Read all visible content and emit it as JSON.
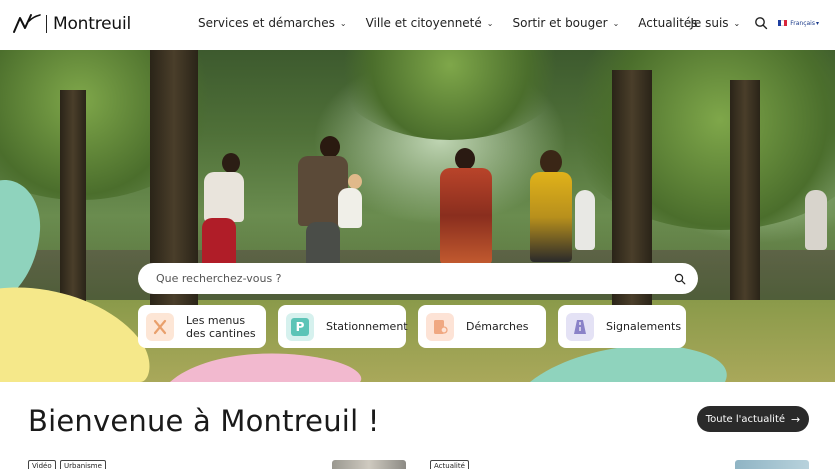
{
  "header": {
    "logo_text": "Montreuil",
    "nav": [
      {
        "label": "Services et démarches"
      },
      {
        "label": "Ville et citoyenneté"
      },
      {
        "label": "Sortir et bouger"
      },
      {
        "label": "Actualités"
      }
    ],
    "je_suis": "Je suis",
    "language": "Français"
  },
  "search": {
    "placeholder": "Que recherchez-vous ?"
  },
  "quick_links": [
    {
      "label_line1": "Les menus",
      "label_line2": "des cantines",
      "icon": "fork-knife-icon",
      "icon_bg": "#fde6d6",
      "icon_color": "#e9b78c"
    },
    {
      "label_line1": "Stationnement",
      "label_line2": "",
      "icon": "parking-icon",
      "icon_bg": "#d6f1ee",
      "icon_color": "#5cc4b7"
    },
    {
      "label_line1": "Démarches",
      "label_line2": "",
      "icon": "document-icon",
      "icon_bg": "#fde3d6",
      "icon_color": "#f0a882"
    },
    {
      "label_line1": "Signalements",
      "label_line2": "",
      "icon": "road-icon",
      "icon_bg": "#e4e2f5",
      "icon_color": "#8a82c8"
    }
  ],
  "welcome": {
    "title": "Bienvenue à Montreuil !",
    "all_news_label": "Toute l'actualité",
    "tags": [
      "Vidéo",
      "Urbanisme",
      "Actualité"
    ]
  },
  "colors": {
    "blob_teal": "#8fd3bd",
    "blob_yellow": "#f5e88a",
    "blob_pink": "#f2b9cf",
    "dark_button": "#2a2a2a"
  }
}
